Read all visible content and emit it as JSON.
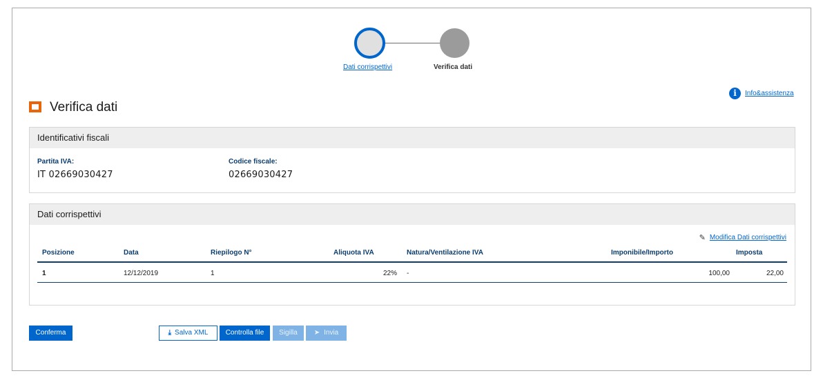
{
  "stepper": {
    "steps": [
      {
        "label": "Dati corrispettivi"
      },
      {
        "label": "Verifica dati"
      }
    ]
  },
  "info": {
    "label": "Info&assistenza",
    "icon": "info-icon"
  },
  "page": {
    "title": "Verifica dati",
    "icon": "folder-icon",
    "accent": "#e8650a"
  },
  "fiscal": {
    "heading": "Identificativi fiscali",
    "partita_iva_label": "Partita IVA:",
    "partita_iva_value": "IT 02669030427",
    "codice_fiscale_label": "Codice fiscale:",
    "codice_fiscale_value": "02669030427"
  },
  "corrispettivi": {
    "heading": "Dati corrispettivi",
    "modify_label": "Modifica Dati corrispettivi",
    "columns": [
      "Posizione",
      "Data",
      "Riepilogo N°",
      "Aliquota IVA",
      "Natura/Ventilazione IVA",
      "Imponibile/Importo",
      "Imposta"
    ],
    "rows": [
      {
        "posizione": "1",
        "data": "12/12/2019",
        "riepilogo": "1",
        "aliquota": "22%",
        "natura": "-",
        "imponibile": "100,00",
        "imposta": "22,00"
      }
    ]
  },
  "actions": {
    "conferma": "Conferma",
    "salva_xml": "Salva XML",
    "controlla_file": "Controlla file",
    "sigilla": "Sigilla",
    "invia": "Invia"
  },
  "colors": {
    "primary": "#0066cc",
    "disabled": "#7fb3e5",
    "header_bg": "#eeeeee"
  }
}
